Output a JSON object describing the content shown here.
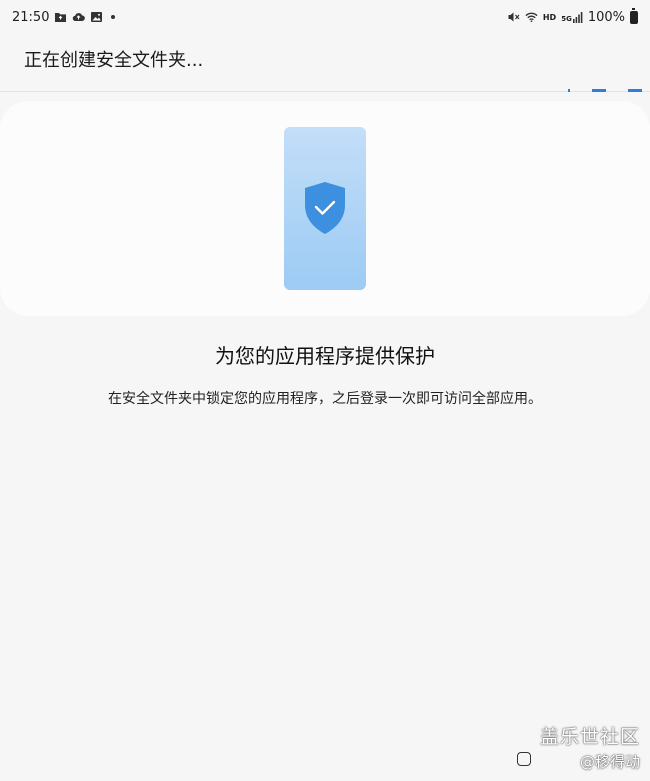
{
  "status_bar": {
    "time": "21:50",
    "left_icons": [
      "folder-icon",
      "cloud-upload-icon",
      "image-icon"
    ],
    "right_icons": [
      "mute-icon",
      "wifi-icon",
      "hd-badge-icon",
      "5g-signal-icon",
      "battery-icon"
    ],
    "hd_label": "HD",
    "network_label": "5G",
    "battery": "100%"
  },
  "header": {
    "title": "正在创建安全文件夹..."
  },
  "hero": {
    "illustration": "phone-shield-check-icon",
    "colors": {
      "phone_top": "#c3def8",
      "phone_bottom": "#9ccbf4",
      "shield": "#3d8fe0"
    }
  },
  "content": {
    "heading": "为您的应用程序提供保护",
    "description": "在安全文件夹中锁定您的应用程序，之后登录一次即可访问全部应用。"
  },
  "watermark": {
    "brand": "盖乐世社区",
    "handle": "@移得动"
  },
  "nav_bar": {
    "buttons": [
      "recents-button"
    ]
  },
  "accent_color": "#2f7de1"
}
